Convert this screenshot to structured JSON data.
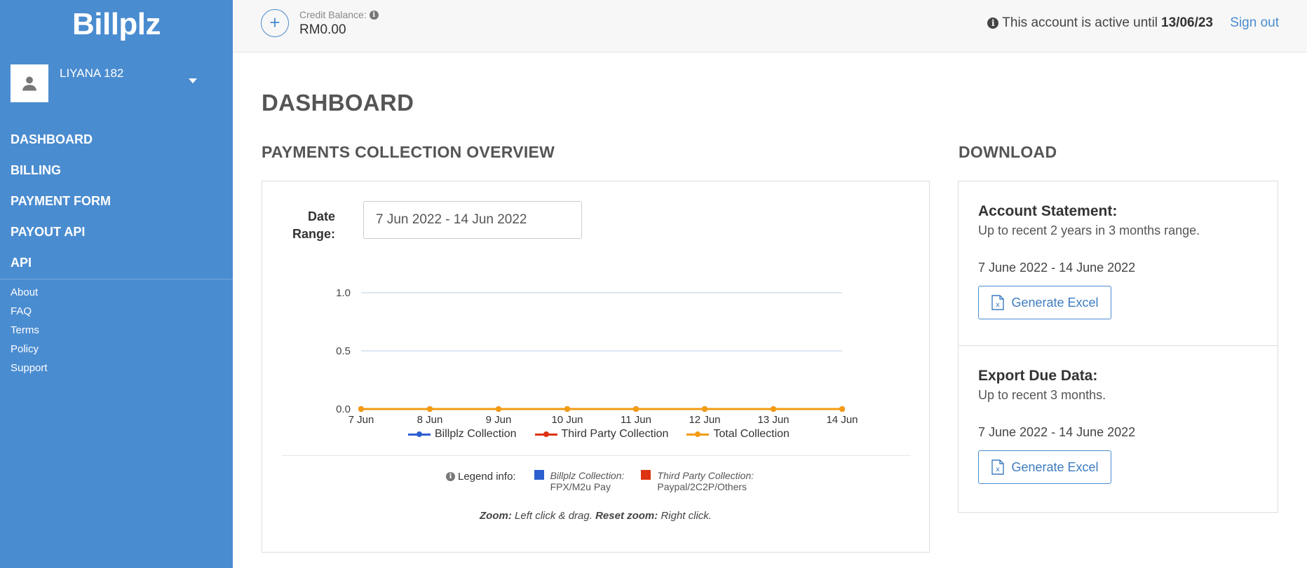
{
  "sidebar": {
    "brand": "Billplz",
    "user_name": "LIYANA 182",
    "nav": [
      "DASHBOARD",
      "BILLING",
      "PAYMENT FORM",
      "PAYOUT API",
      "API"
    ],
    "links": [
      "About",
      "FAQ",
      "Terms",
      "Policy",
      "Support"
    ]
  },
  "topbar": {
    "credit_label": "Credit Balance:",
    "credit_value": "RM0.00",
    "account_prefix": "This account is active until",
    "account_date": "13/06/23",
    "signout": "Sign out"
  },
  "page": {
    "title": "DASHBOARD",
    "overview_title": "PAYMENTS COLLECTION OVERVIEW",
    "download_title": "DOWNLOAD"
  },
  "overview": {
    "date_label": "Date Range:",
    "date_value": "7 Jun 2022 - 14 Jun 2022",
    "legend_info_label": "Legend info:",
    "legend_info": [
      {
        "name": "Billplz Collection:",
        "detail": "FPX/M2u Pay",
        "color": "#2d5fd0"
      },
      {
        "name": "Third Party Collection:",
        "detail": "Paypal/2C2P/Others",
        "color": "#dd3311"
      }
    ],
    "zoom_bold": "Zoom:",
    "zoom_text": "Left click & drag.",
    "reset_bold": "Reset zoom:",
    "reset_text": "Right click."
  },
  "chart_data": {
    "type": "line",
    "categories": [
      "7 Jun",
      "8 Jun",
      "9 Jun",
      "10 Jun",
      "11 Jun",
      "12 Jun",
      "13 Jun",
      "14 Jun"
    ],
    "yticks": [
      "1.0",
      "0.5",
      "0.0"
    ],
    "ylim": [
      0,
      1
    ],
    "grid": true,
    "legend_position": "bottom",
    "series": [
      {
        "name": "Billplz Collection",
        "color": "#2d5fd0",
        "values": [
          0,
          0,
          0,
          0,
          0,
          0,
          0,
          0
        ]
      },
      {
        "name": "Third Party Collection",
        "color": "#dd3311",
        "values": [
          0,
          0,
          0,
          0,
          0,
          0,
          0,
          0
        ]
      },
      {
        "name": "Total Collection",
        "color": "#f39c12",
        "values": [
          0,
          0,
          0,
          0,
          0,
          0,
          0,
          0
        ]
      }
    ]
  },
  "download": {
    "statement_title": "Account Statement:",
    "statement_sub": "Up to recent 2 years in 3 months range.",
    "statement_range": "7 June 2022 - 14 June 2022",
    "export_title": "Export Due Data:",
    "export_sub": "Up to recent 3 months.",
    "export_range": "7 June 2022 - 14 June 2022",
    "button_label": "Generate Excel"
  },
  "colors": {
    "sidebar": "#4a8cd0",
    "accent": "#4a8cd0"
  }
}
